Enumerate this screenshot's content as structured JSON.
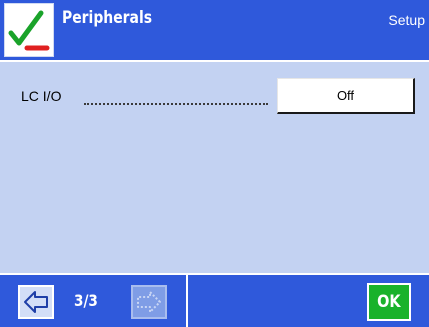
{
  "header": {
    "title": "Peripherals",
    "mode": "Setup",
    "icon": "checkmark-minus-icon"
  },
  "settings": [
    {
      "label": "LC I/O",
      "value": "Off"
    }
  ],
  "footer": {
    "page_indicator": "3/3",
    "prev_icon": "arrow-left-icon",
    "next_icon": "arrow-right-icon",
    "ok_label": "OK"
  },
  "colors": {
    "bar": "#2f59db",
    "content_bg": "#c3d2f2",
    "ok_green": "#19b22b",
    "check_green": "#1aa32a",
    "minus_red": "#e02020"
  }
}
